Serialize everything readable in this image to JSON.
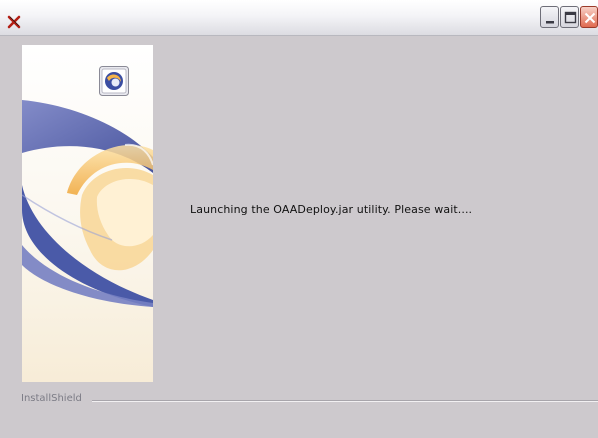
{
  "window": {
    "title": "",
    "controls": {
      "minimize_icon": "minimize-icon",
      "maximize_icon": "maximize-icon",
      "close_icon": "close-icon"
    }
  },
  "main": {
    "status_message": "Launching the OAADeploy.jar utility.  Please wait...."
  },
  "footer": {
    "brand_label": "InstallShield"
  },
  "colors": {
    "window_background": "#cdc9cd",
    "swoosh_blue": "#4a5aa8",
    "swoosh_gold": "#f2b24a",
    "close_button": "#e06a50"
  }
}
